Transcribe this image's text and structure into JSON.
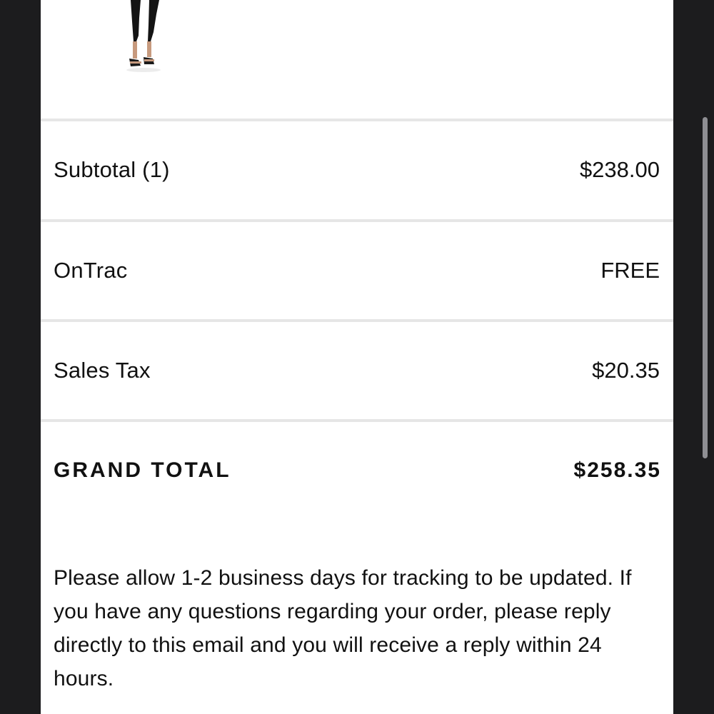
{
  "product": {
    "image_icon": "product-image-legs-heels"
  },
  "summary": {
    "subtotal": {
      "label": "Subtotal (1)",
      "value": "$238.00"
    },
    "shipping": {
      "label": "OnTrac",
      "value": "FREE"
    },
    "tax": {
      "label": "Sales Tax",
      "value": "$20.35"
    },
    "grand_total": {
      "label": "GRAND TOTAL",
      "value": "$258.35"
    }
  },
  "notice": {
    "text": "Please allow 1-2 business days for tracking to be updated. If you have any questions regarding your order, please reply directly to this email and you will receive a reply within 24 hours."
  },
  "colors": {
    "background": "#1c1c1e",
    "card": "#ffffff",
    "divider": "#e6e6e6",
    "text": "#111111",
    "scrollbar": "#8e8e93"
  }
}
